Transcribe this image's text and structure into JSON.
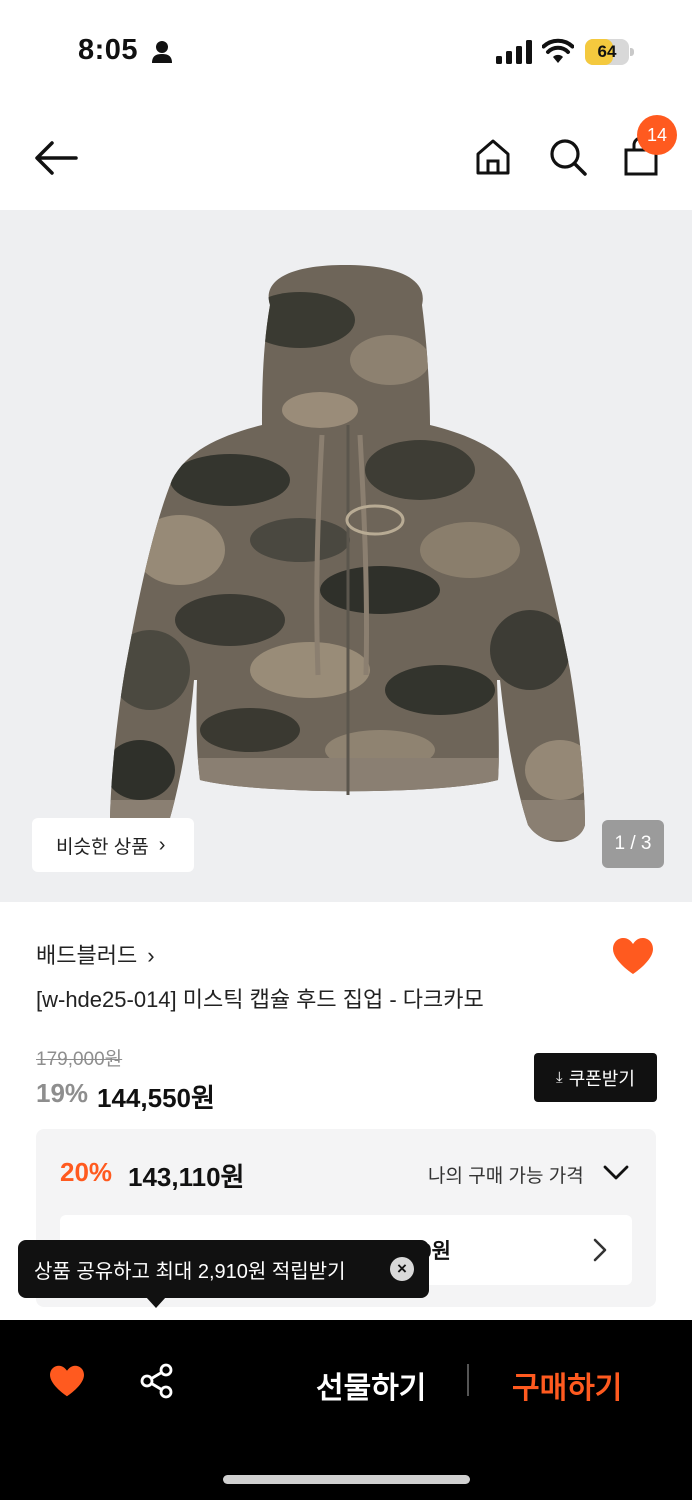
{
  "status_bar": {
    "time": "8:05",
    "battery": "64"
  },
  "nav": {
    "cart_badge": "14"
  },
  "gallery": {
    "similar_label": "비슷한 상품",
    "counter": "1 / 3"
  },
  "product": {
    "brand": "배드블러드",
    "title": "[w-hde25-014] 미스틱 캡슐 후드 집업 - 다크카모",
    "original_price": "179,000원",
    "discount": "19%",
    "sale_price": "144,550원",
    "coupon_label": "쿠폰받기"
  },
  "my_price": {
    "discount": "20%",
    "price": "143,110원",
    "label": "나의 구매 가능 가격",
    "row_text_visible": "0원"
  },
  "tooltip": {
    "text": "상품 공유하고 최대 2,910원 적립받기"
  },
  "bottom_bar": {
    "gift_label": "선물하기",
    "buy_label": "구매하기"
  },
  "colors": {
    "accent": "#ff5a1f",
    "dark": "#000000",
    "camo_base": "#6b6256"
  }
}
